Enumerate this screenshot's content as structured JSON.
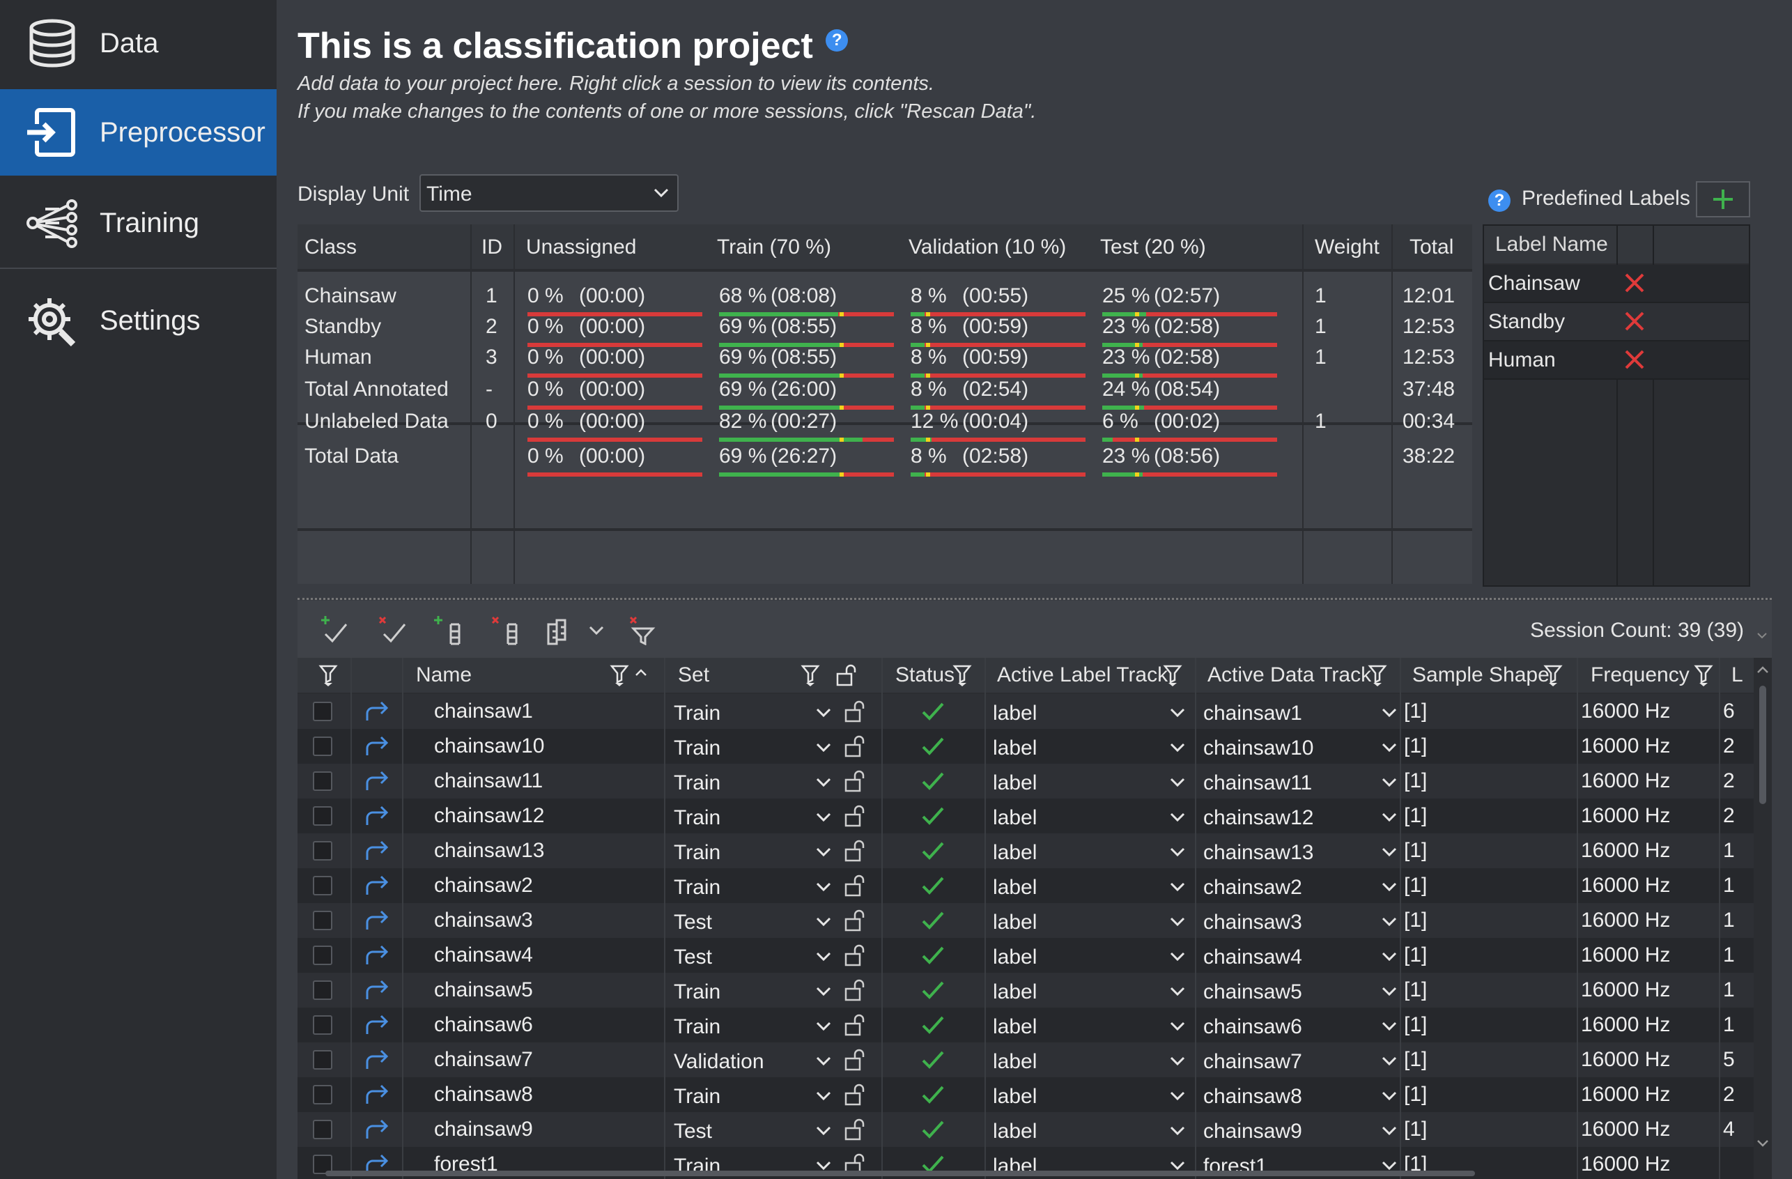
{
  "sidebar": {
    "items": [
      {
        "label": "Data",
        "icon": "database-icon"
      },
      {
        "label": "Preprocessor",
        "icon": "import-icon"
      },
      {
        "label": "Training",
        "icon": "network-icon"
      },
      {
        "label": "Settings",
        "icon": "gear-wrench-icon"
      }
    ],
    "active": "Preprocessor",
    "active_color": "#1a5fa8"
  },
  "header": {
    "title": "This is a classification project",
    "help": "?",
    "line1": "Add data to your project here. Right click a session to view its contents.",
    "line2": "If you make changes to the contents of one or more sessions, click \"Rescan Data\"."
  },
  "display_unit": {
    "label": "Display Unit",
    "value": "Time"
  },
  "summary": {
    "headers": {
      "class": "Class",
      "id": "ID",
      "unassigned": "Unassigned",
      "train": "Train (70 %)",
      "validation": "Validation (10 %)",
      "test": "Test (20 %)",
      "weight": "Weight",
      "total": "Total"
    },
    "rows": [
      {
        "class": "Chainsaw",
        "id": "1",
        "unassigned": {
          "pct": "0 %",
          "time": "(00:00)",
          "fill": 0
        },
        "train": {
          "pct": "68 %",
          "time": "(08:08)",
          "fill": 0.68
        },
        "validation": {
          "pct": "8 %",
          "time": "(00:55)",
          "fill": 0.08
        },
        "test": {
          "pct": "25 %",
          "time": "(02:57)",
          "fill": 0.25
        },
        "weight": "1",
        "total": "12:01"
      },
      {
        "class": "Standby",
        "id": "2",
        "unassigned": {
          "pct": "0 %",
          "time": "(00:00)",
          "fill": 0
        },
        "train": {
          "pct": "69 %",
          "time": "(08:55)",
          "fill": 0.69
        },
        "validation": {
          "pct": "8 %",
          "time": "(00:59)",
          "fill": 0.08
        },
        "test": {
          "pct": "23 %",
          "time": "(02:58)",
          "fill": 0.23
        },
        "weight": "1",
        "total": "12:53"
      },
      {
        "class": "Human",
        "id": "3",
        "unassigned": {
          "pct": "0 %",
          "time": "(00:00)",
          "fill": 0
        },
        "train": {
          "pct": "69 %",
          "time": "(08:55)",
          "fill": 0.69
        },
        "validation": {
          "pct": "8 %",
          "time": "(00:59)",
          "fill": 0.08
        },
        "test": {
          "pct": "23 %",
          "time": "(02:58)",
          "fill": 0.23
        },
        "weight": "1",
        "total": "12:53"
      },
      {
        "class": "Total Annotated",
        "id": "-",
        "unassigned": {
          "pct": "0 %",
          "time": "(00:00)",
          "fill": 0
        },
        "train": {
          "pct": "69 %",
          "time": "(26:00)",
          "fill": 0.69
        },
        "validation": {
          "pct": "8 %",
          "time": "(02:54)",
          "fill": 0.08
        },
        "test": {
          "pct": "24 %",
          "time": "(08:54)",
          "fill": 0.24
        },
        "weight": "",
        "total": "37:48"
      },
      {
        "class": "Unlabeled Data",
        "id": "0",
        "unassigned": {
          "pct": "0 %",
          "time": "(00:00)",
          "fill": 0
        },
        "train": {
          "pct": "82 %",
          "time": "(00:27)",
          "fill": 0.82
        },
        "validation": {
          "pct": "12 %",
          "time": "(00:04)",
          "fill": 0.12
        },
        "test": {
          "pct": "6 %",
          "time": "(00:02)",
          "fill": 0.06
        },
        "weight": "1",
        "total": "00:34"
      },
      {
        "class": "Total Data",
        "id": "",
        "unassigned": {
          "pct": "0 %",
          "time": "(00:00)",
          "fill": 0
        },
        "train": {
          "pct": "69 %",
          "time": "(26:27)",
          "fill": 0.69
        },
        "validation": {
          "pct": "8 %",
          "time": "(02:58)",
          "fill": 0.08
        },
        "test": {
          "pct": "23 %",
          "time": "(08:56)",
          "fill": 0.23
        },
        "weight": "",
        "total": "38:22"
      }
    ],
    "target": {
      "train": 0.7,
      "validation": 0.1,
      "test": 0.2,
      "unassigned": 0
    }
  },
  "predefined_labels": {
    "title": "Predefined Labels",
    "header": "Label Name",
    "labels": [
      "Chainsaw",
      "Standby",
      "Human"
    ]
  },
  "sessions": {
    "count_text": "Session Count: 39 (39)",
    "columns": {
      "name": "Name",
      "set": "Set",
      "status": "Status",
      "label_track": "Active Label Track",
      "data_track": "Active Data Track",
      "shape": "Sample Shape",
      "frequency": "Frequency",
      "last": "L"
    },
    "rows": [
      {
        "name": "chainsaw1",
        "set": "Train",
        "label": "label",
        "track": "chainsaw1",
        "shape": "[1]",
        "freq": "16000 Hz",
        "last": "6"
      },
      {
        "name": "chainsaw10",
        "set": "Train",
        "label": "label",
        "track": "chainsaw10",
        "shape": "[1]",
        "freq": "16000 Hz",
        "last": "2"
      },
      {
        "name": "chainsaw11",
        "set": "Train",
        "label": "label",
        "track": "chainsaw11",
        "shape": "[1]",
        "freq": "16000 Hz",
        "last": "2"
      },
      {
        "name": "chainsaw12",
        "set": "Train",
        "label": "label",
        "track": "chainsaw12",
        "shape": "[1]",
        "freq": "16000 Hz",
        "last": "2"
      },
      {
        "name": "chainsaw13",
        "set": "Train",
        "label": "label",
        "track": "chainsaw13",
        "shape": "[1]",
        "freq": "16000 Hz",
        "last": "1"
      },
      {
        "name": "chainsaw2",
        "set": "Train",
        "label": "label",
        "track": "chainsaw2",
        "shape": "[1]",
        "freq": "16000 Hz",
        "last": "1"
      },
      {
        "name": "chainsaw3",
        "set": "Test",
        "label": "label",
        "track": "chainsaw3",
        "shape": "[1]",
        "freq": "16000 Hz",
        "last": "1"
      },
      {
        "name": "chainsaw4",
        "set": "Test",
        "label": "label",
        "track": "chainsaw4",
        "shape": "[1]",
        "freq": "16000 Hz",
        "last": "1"
      },
      {
        "name": "chainsaw5",
        "set": "Train",
        "label": "label",
        "track": "chainsaw5",
        "shape": "[1]",
        "freq": "16000 Hz",
        "last": "1"
      },
      {
        "name": "chainsaw6",
        "set": "Train",
        "label": "label",
        "track": "chainsaw6",
        "shape": "[1]",
        "freq": "16000 Hz",
        "last": "1"
      },
      {
        "name": "chainsaw7",
        "set": "Validation",
        "label": "label",
        "track": "chainsaw7",
        "shape": "[1]",
        "freq": "16000 Hz",
        "last": "5"
      },
      {
        "name": "chainsaw8",
        "set": "Train",
        "label": "label",
        "track": "chainsaw8",
        "shape": "[1]",
        "freq": "16000 Hz",
        "last": "2"
      },
      {
        "name": "chainsaw9",
        "set": "Test",
        "label": "label",
        "track": "chainsaw9",
        "shape": "[1]",
        "freq": "16000 Hz",
        "last": "4"
      },
      {
        "name": "forest1",
        "set": "Train",
        "label": "label",
        "track": "forest1",
        "shape": "[1]",
        "freq": "16000 Hz",
        "last": ""
      }
    ]
  },
  "colors": {
    "bar_fill": "#3fb24d",
    "bar_remaining": "#d83a3a",
    "bar_target": "#f2d21b",
    "status_ok": "#3fb24d",
    "delete": "#e03a3a",
    "link": "#4a90e2"
  }
}
